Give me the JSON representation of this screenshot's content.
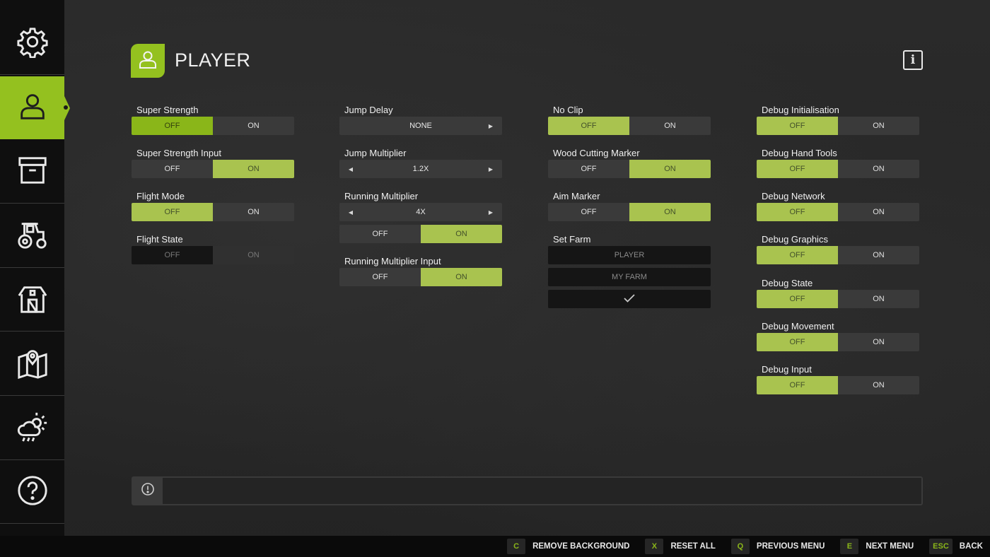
{
  "sidebar": {
    "items": [
      {
        "name": "sidebar-item-settings",
        "icon": "gear-icon"
      },
      {
        "name": "sidebar-item-player",
        "icon": "user-icon",
        "active": true
      },
      {
        "name": "sidebar-item-storage",
        "icon": "archive-box-icon"
      },
      {
        "name": "sidebar-item-vehicles",
        "icon": "tractor-icon"
      },
      {
        "name": "sidebar-item-farm",
        "icon": "barn-icon"
      },
      {
        "name": "sidebar-item-map",
        "icon": "map-pin-icon"
      },
      {
        "name": "sidebar-item-weather",
        "icon": "weather-icon"
      },
      {
        "name": "sidebar-item-help",
        "icon": "question-icon"
      }
    ]
  },
  "header": {
    "title": "PLAYER",
    "icon": "user-icon",
    "info_label": "i"
  },
  "colors": {
    "accent": "#94c11f",
    "selected": "#a9c34f",
    "option_bg": "#3a3a3a",
    "sidebar_bg": "#0f0f0f"
  },
  "columns": {
    "col1": {
      "super_strength": {
        "label": "Super Strength",
        "off": "OFF",
        "on": "ON",
        "value": "OFF"
      },
      "super_strength_input": {
        "label": "Super Strength Input",
        "off": "OFF",
        "on": "ON",
        "value": "ON"
      },
      "flight_mode": {
        "label": "Flight Mode",
        "off": "OFF",
        "on": "ON",
        "value": "OFF"
      },
      "flight_state": {
        "label": "Flight State",
        "off": "OFF",
        "on": "ON",
        "value": "OFF",
        "disabled": true
      }
    },
    "col2": {
      "jump_delay": {
        "label": "Jump Delay",
        "value": "NONE"
      },
      "jump_multiplier": {
        "label": "Jump Multiplier",
        "value": "1.2X"
      },
      "running_multiplier": {
        "label": "Running Multiplier",
        "value": "4X",
        "off": "OFF",
        "on": "ON",
        "toggle_value": "ON"
      },
      "running_multiplier_input": {
        "label": "Running Multiplier Input",
        "off": "OFF",
        "on": "ON",
        "value": "ON"
      }
    },
    "col3": {
      "no_clip": {
        "label": "No Clip",
        "off": "OFF",
        "on": "ON",
        "value": "OFF"
      },
      "wood_cutting_marker": {
        "label": "Wood Cutting Marker",
        "off": "OFF",
        "on": "ON",
        "value": "ON"
      },
      "aim_marker": {
        "label": "Aim Marker",
        "off": "OFF",
        "on": "ON",
        "value": "ON"
      },
      "set_farm": {
        "label": "Set Farm",
        "options": [
          "PLAYER",
          "MY FARM"
        ],
        "confirm_icon": "checkmark-icon"
      }
    },
    "col4": {
      "debug_initialisation": {
        "label": "Debug Initialisation",
        "off": "OFF",
        "on": "ON",
        "value": "OFF"
      },
      "debug_hand_tools": {
        "label": "Debug Hand Tools",
        "off": "OFF",
        "on": "ON",
        "value": "OFF"
      },
      "debug_network": {
        "label": "Debug Network",
        "off": "OFF",
        "on": "ON",
        "value": "OFF"
      },
      "debug_graphics": {
        "label": "Debug Graphics",
        "off": "OFF",
        "on": "ON",
        "value": "OFF"
      },
      "debug_state": {
        "label": "Debug State",
        "off": "OFF",
        "on": "ON",
        "value": "OFF"
      },
      "debug_movement": {
        "label": "Debug Movement",
        "off": "OFF",
        "on": "ON",
        "value": "OFF"
      },
      "debug_input": {
        "label": "Debug Input",
        "off": "OFF",
        "on": "ON",
        "value": "OFF"
      }
    }
  },
  "help_bar": {
    "icon": "exclamation-circle-icon",
    "text": ""
  },
  "footer": {
    "actions": [
      {
        "key": "C",
        "label": "REMOVE BACKGROUND"
      },
      {
        "key": "X",
        "label": "RESET ALL"
      },
      {
        "key": "Q",
        "label": "PREVIOUS MENU"
      },
      {
        "key": "E",
        "label": "NEXT MENU"
      },
      {
        "key": "ESC",
        "label": "BACK"
      }
    ]
  }
}
